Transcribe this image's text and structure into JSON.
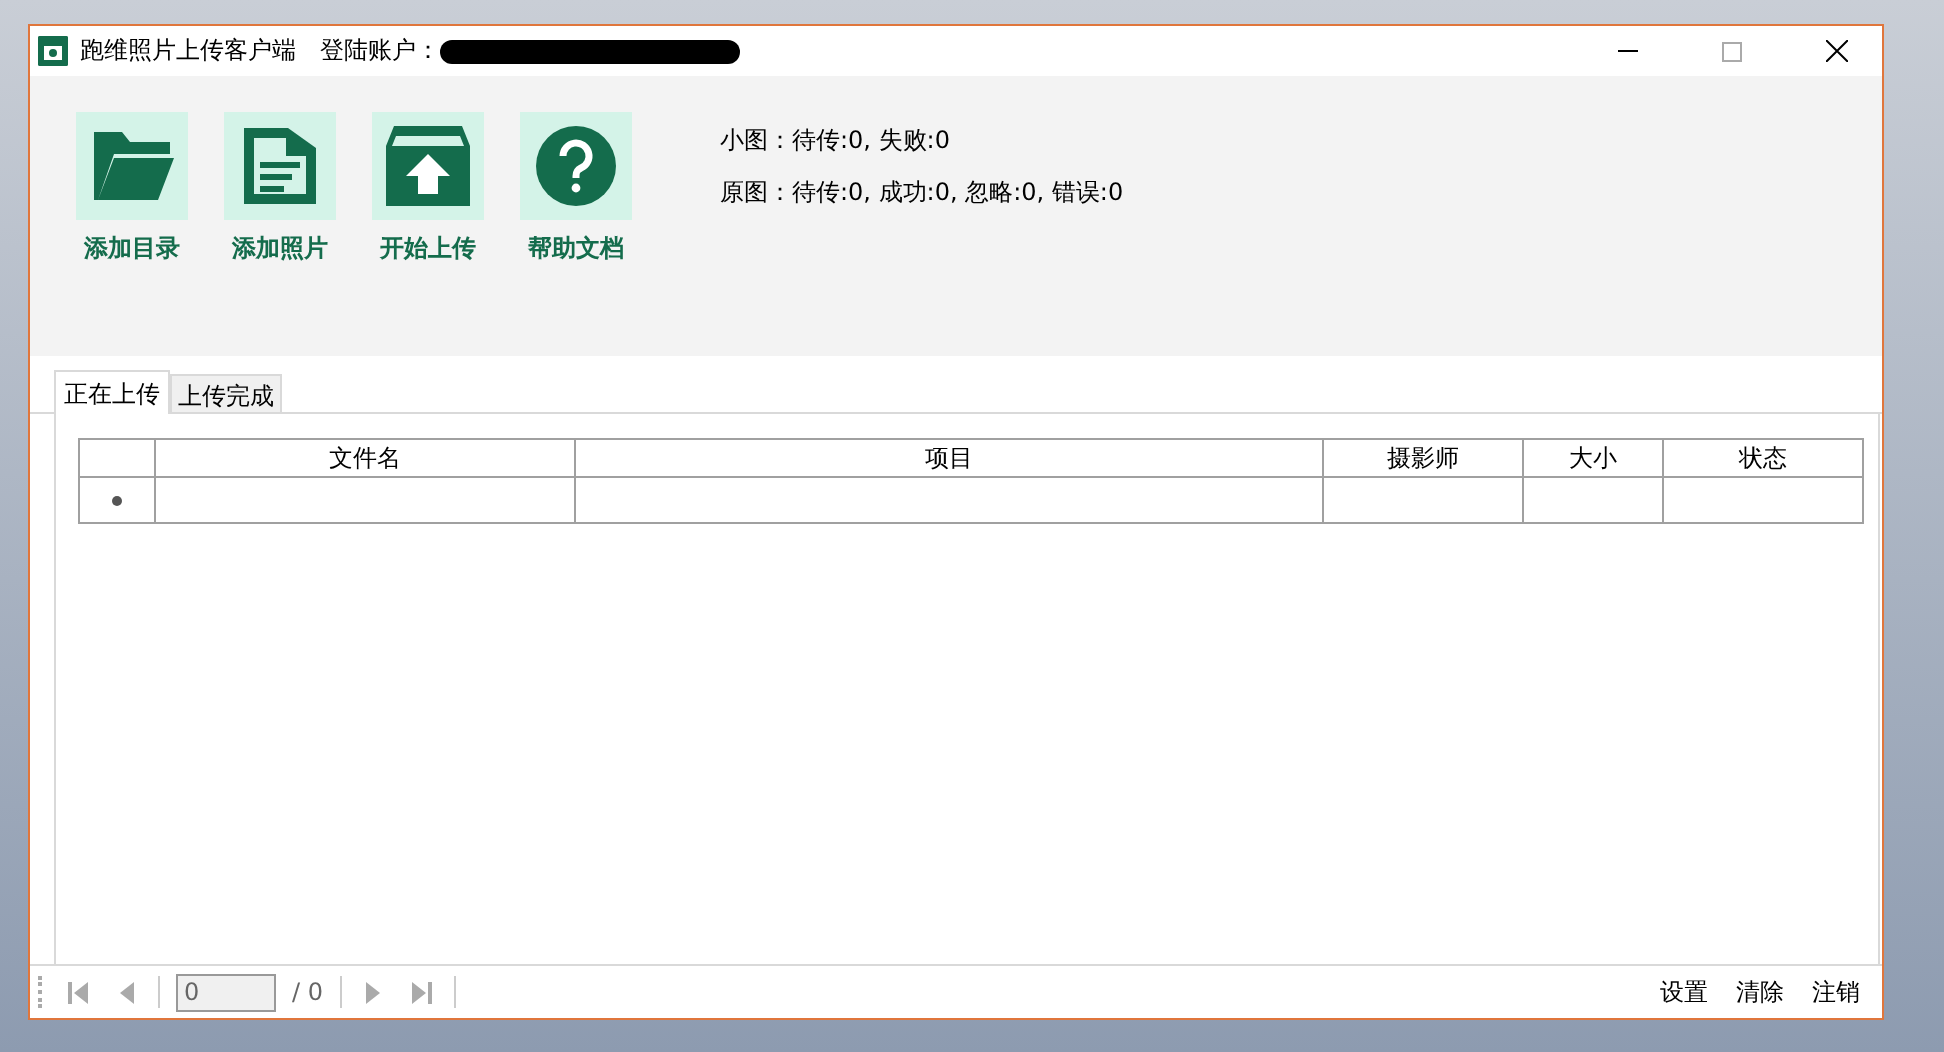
{
  "window": {
    "title": "跑维照片上传客户端",
    "account_label": "登陆账户："
  },
  "toolbar": [
    {
      "label": "添加目录",
      "kind": "folder"
    },
    {
      "label": "添加照片",
      "kind": "document"
    },
    {
      "label": "开始上传",
      "kind": "upload"
    },
    {
      "label": "帮助文档",
      "kind": "help"
    }
  ],
  "stats": [
    "小图：待传:0, 失败:0",
    "原图：待传:0, 成功:0, 忽略:0, 错误:0"
  ],
  "tabs": [
    {
      "label": "正在上传",
      "selected": true
    },
    {
      "label": "上传完成",
      "selected": false
    }
  ],
  "table": {
    "columns": [
      "文件名",
      "项目",
      "摄影师",
      "大小",
      "状态"
    ]
  },
  "pager": {
    "page": "0",
    "total": "/ 0"
  },
  "footer_links": [
    "设置",
    "清除",
    "注销"
  ]
}
